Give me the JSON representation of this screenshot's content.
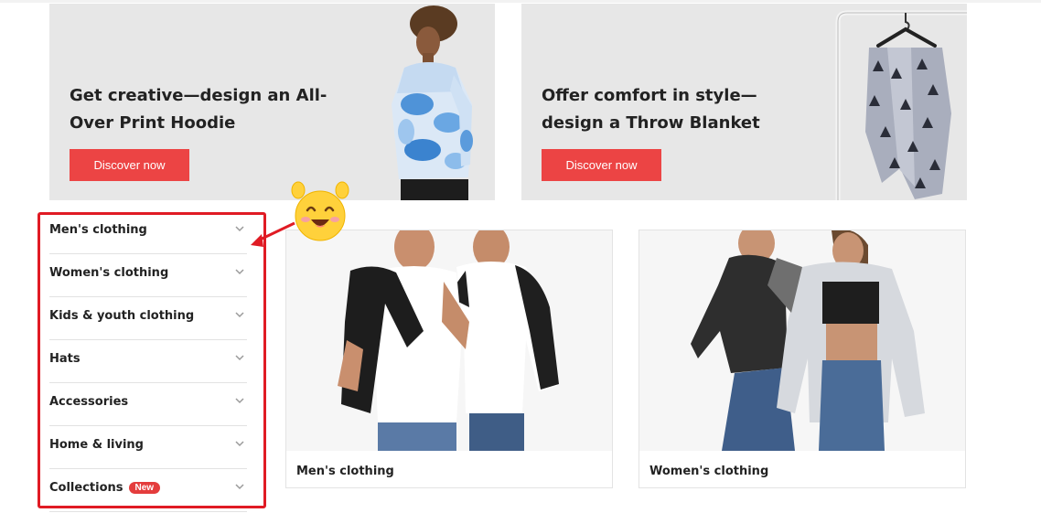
{
  "banners": [
    {
      "title": "Get creative—design an All-Over Print Hoodie",
      "cta": "Discover now"
    },
    {
      "title": "Offer comfort in style—design a Throw Blanket",
      "cta": "Discover now"
    }
  ],
  "sidebar": {
    "items": [
      {
        "label": "Men's clothing"
      },
      {
        "label": "Women's clothing"
      },
      {
        "label": "Kids & youth clothing"
      },
      {
        "label": "Hats"
      },
      {
        "label": "Accessories"
      },
      {
        "label": "Home & living"
      },
      {
        "label": "Collections",
        "badge": "New"
      }
    ],
    "chevron_icon": "chevron-down-icon"
  },
  "cards": [
    {
      "label": "Men's clothing"
    },
    {
      "label": "Women's clothing"
    }
  ],
  "colors": {
    "accent": "#ec4444",
    "annotation": "#e01b24",
    "banner_bg": "#e7e7e7"
  }
}
